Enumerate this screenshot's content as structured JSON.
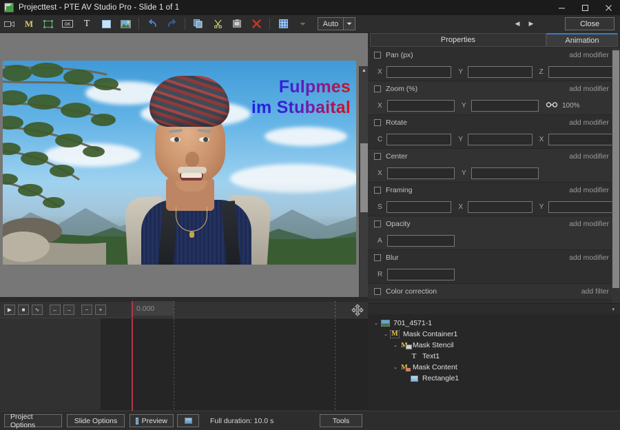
{
  "window": {
    "title": "Projecttest - PTE AV Studio Pro - Slide 1 of 1",
    "app_icon": "app-logo-icon",
    "minimize": "–",
    "maximize": "□",
    "close": "✕"
  },
  "toolbar": {
    "items": [
      {
        "name": "video-camera-icon",
        "glyph": "🎥"
      },
      {
        "name": "mask-icon",
        "glyph": "M"
      },
      {
        "name": "frame-icon",
        "glyph": "▣"
      },
      {
        "name": "button-object-icon",
        "glyph": "OK"
      },
      {
        "name": "text-object-icon",
        "glyph": "T"
      },
      {
        "name": "rectangle-object-icon",
        "glyph": "▪"
      },
      {
        "name": "image-object-icon",
        "glyph": "🖼"
      },
      {
        "name": "undo-icon",
        "glyph": "↶"
      },
      {
        "name": "redo-icon",
        "glyph": "↷"
      },
      {
        "name": "copy-icon",
        "glyph": "⧉"
      },
      {
        "name": "cut-icon",
        "glyph": "✂"
      },
      {
        "name": "paste-icon",
        "glyph": "📋"
      },
      {
        "name": "delete-icon",
        "glyph": "✕"
      },
      {
        "name": "grid-icon",
        "glyph": "▦"
      },
      {
        "name": "grid-dropdown-icon",
        "glyph": "▾"
      }
    ],
    "zoom_select_value": "Auto",
    "zoom_select_arrow": "▼",
    "nav_prev": "◀",
    "nav_next": "▶",
    "close_label": "Close"
  },
  "preview": {
    "overlay_text": "Fulpmes\nim Stubaital",
    "overlay_gradient_from": "#1822e8",
    "overlay_gradient_to": "#e01020",
    "background_color": "#777777",
    "scroll_up": "▲",
    "scroll_down": "▼",
    "scroll_left": "◀",
    "scroll_right": "▶"
  },
  "timeline": {
    "buttons": [
      {
        "name": "play-button",
        "glyph": "▶"
      },
      {
        "name": "stop-button",
        "glyph": "■"
      },
      {
        "name": "waveform-button",
        "glyph": "∿"
      },
      {
        "name": "prev-keyframe-button",
        "glyph": "←"
      },
      {
        "name": "next-keyframe-button",
        "glyph": "→"
      },
      {
        "name": "zoom-out-button",
        "glyph": "−"
      },
      {
        "name": "zoom-in-button",
        "glyph": "+"
      }
    ],
    "time_label": "0.000",
    "move_tool": "✥"
  },
  "right_panel": {
    "tabs": [
      {
        "label": "Properties",
        "active": false
      },
      {
        "label": "Animation",
        "active": true
      }
    ],
    "accent_color": "#2f7fd4",
    "groups": [
      {
        "label": "Pan (px)",
        "modifier": "add modifier",
        "fields": [
          {
            "axis": "X",
            "value": ""
          },
          {
            "axis": "Y",
            "value": ""
          },
          {
            "axis": "Z",
            "value": ""
          }
        ]
      },
      {
        "label": "Zoom (%)",
        "modifier": "add modifier",
        "fields": [
          {
            "axis": "X",
            "value": ""
          },
          {
            "axis": "Y",
            "value": ""
          }
        ],
        "link_icon": "link-chain-icon",
        "percent": "100%"
      },
      {
        "label": "Rotate",
        "modifier": "add modifier",
        "fields": [
          {
            "axis": "C",
            "value": ""
          },
          {
            "axis": "Y",
            "value": ""
          },
          {
            "axis": "X",
            "value": ""
          }
        ]
      },
      {
        "label": "Center",
        "modifier": "add modifier",
        "fields": [
          {
            "axis": "X",
            "value": ""
          },
          {
            "axis": "Y",
            "value": ""
          }
        ]
      },
      {
        "label": "Framing",
        "modifier": "add modifier",
        "fields": [
          {
            "axis": "S",
            "value": ""
          },
          {
            "axis": "X",
            "value": ""
          },
          {
            "axis": "Y",
            "value": ""
          }
        ]
      },
      {
        "label": "Opacity",
        "modifier": "add modifier",
        "fields": [
          {
            "axis": "A",
            "value": ""
          }
        ]
      },
      {
        "label": "Blur",
        "modifier": "add modifier",
        "fields": [
          {
            "axis": "R",
            "value": ""
          }
        ]
      },
      {
        "label": "Color correction",
        "modifier": "add filter",
        "fields": []
      }
    ]
  },
  "object_tree": {
    "collapse_icon": "▾",
    "nodes": [
      {
        "label": "701_4571-1",
        "icon": "image-icon",
        "chevron": "⌄",
        "depth": 0
      },
      {
        "label": "Mask Container1",
        "icon": "mask-container-icon",
        "chevron": "⌄",
        "depth": 1
      },
      {
        "label": "Mask Stencil",
        "icon": "mask-stencil-icon",
        "chevron": "⌄",
        "depth": 2
      },
      {
        "label": "Text1",
        "icon": "text-icon",
        "chevron": "",
        "depth": 3
      },
      {
        "label": "Mask Content",
        "icon": "mask-content-icon",
        "chevron": "⌄",
        "depth": 2
      },
      {
        "label": "Rectangle1",
        "icon": "rectangle-icon",
        "chevron": "",
        "depth": 3
      }
    ]
  },
  "bottom_bar": {
    "project_options": "Project Options",
    "slide_options": "Slide Options",
    "preview": "Preview",
    "fullscreen_icon": "fullscreen-preview-icon",
    "duration": "Full duration: 10.0 s",
    "tools": "Tools"
  }
}
